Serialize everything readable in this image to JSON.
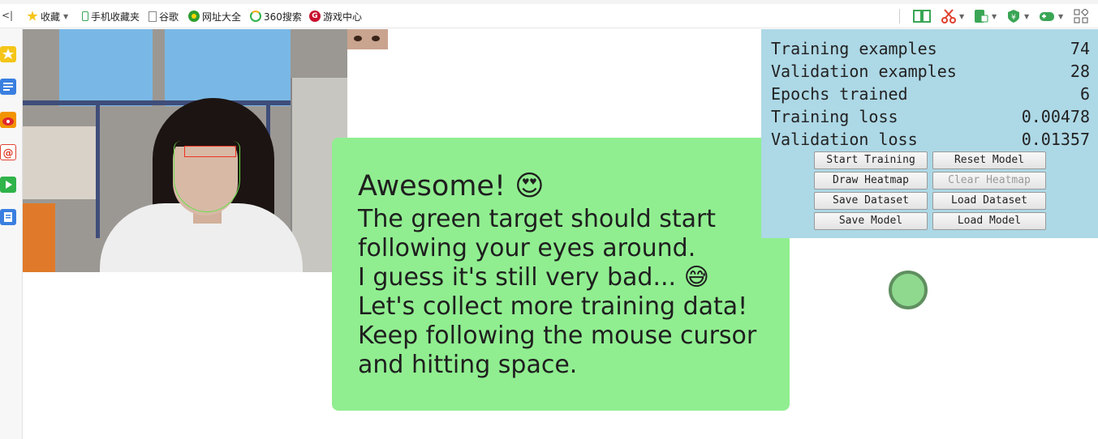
{
  "bookmarks_bar": {
    "back_label": "<|",
    "items": [
      {
        "label": "收藏",
        "icon": "star-icon",
        "has_caret": true
      },
      {
        "label": "手机收藏夹",
        "icon": "phone-icon"
      },
      {
        "label": "谷歌",
        "icon": "document-icon"
      },
      {
        "label": "网址大全",
        "icon": "web-directory-icon"
      },
      {
        "label": "360搜索",
        "icon": "search-360-icon"
      },
      {
        "label": "游戏中心",
        "icon": "game-center-icon"
      }
    ],
    "right_icons": [
      "reading-mode-icon",
      "scissors-icon",
      "translate-icon",
      "payment-icon",
      "gamepad-icon",
      "grid-menu-icon"
    ]
  },
  "sidebar": {
    "icons": [
      "favorites-star-icon",
      "news-icon",
      "weibo-icon",
      "mail-icon",
      "video-icon",
      "notes-icon"
    ]
  },
  "message": {
    "title": "Awesome! 😍",
    "body": "The green target should start\nfollowing your eyes around.\nI guess it's still very bad... 😅\nLet's collect more training data!\nKeep following the mouse cursor\nand hitting space."
  },
  "stats": [
    {
      "label": "Training examples",
      "value": "74"
    },
    {
      "label": "Validation examples",
      "value": "28"
    },
    {
      "label": "Epochs trained",
      "value": "6"
    },
    {
      "label": "Training loss",
      "value": "0.00478"
    },
    {
      "label": "Validation loss",
      "value": "0.01357"
    }
  ],
  "buttons": {
    "start_training": "Start Training",
    "reset_model": "Reset Model",
    "draw_heatmap": "Draw Heatmap",
    "clear_heatmap": "Clear Heatmap",
    "save_dataset": "Save Dataset",
    "load_dataset": "Load Dataset",
    "save_model": "Save Model",
    "load_model": "Load Model"
  },
  "colors": {
    "card_bg": "#90ee90",
    "panel_bg": "#add8e6",
    "target_fill": "#8fd98f",
    "target_border": "#5f8f5f"
  }
}
